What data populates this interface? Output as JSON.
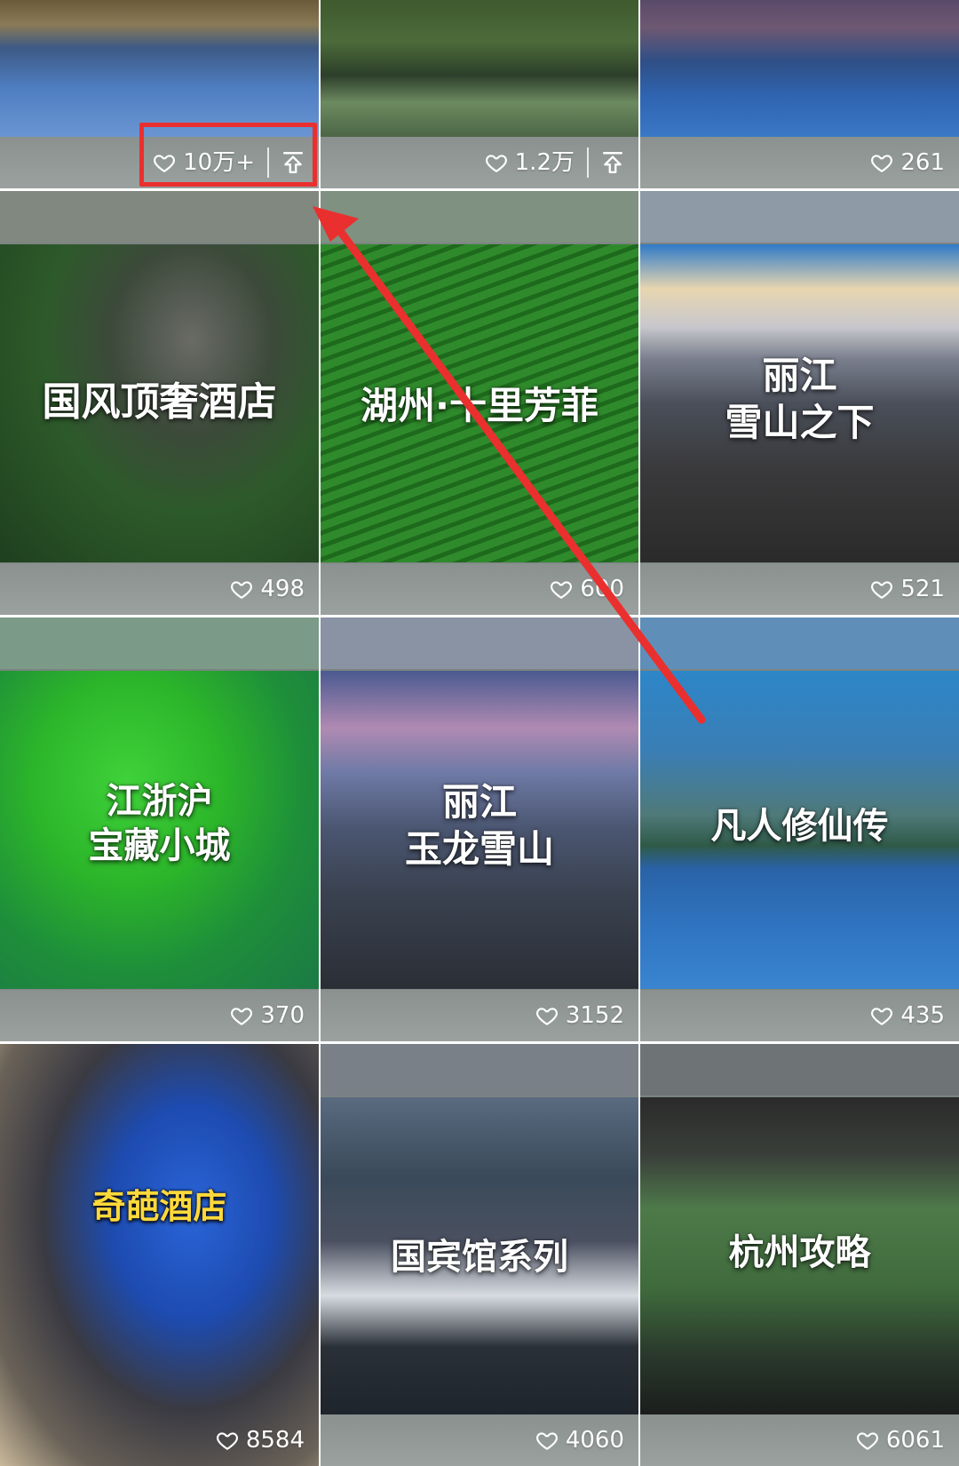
{
  "tiles": [
    {
      "likes": "10万+",
      "caption": "",
      "pinned": true
    },
    {
      "likes": "1.2万",
      "caption": "",
      "pinned": true
    },
    {
      "likes": "261",
      "caption": "",
      "pinned": false
    },
    {
      "likes": "498",
      "caption": "国风顶奢酒店",
      "pinned": false
    },
    {
      "likes": "600",
      "caption": "湖州·十里芳菲",
      "pinned": false
    },
    {
      "likes": "521",
      "caption": "丽江\n雪山之下",
      "pinned": false
    },
    {
      "likes": "370",
      "caption": "江浙沪\n宝藏小城",
      "pinned": false
    },
    {
      "likes": "3152",
      "caption": "丽江\n玉龙雪山",
      "pinned": false
    },
    {
      "likes": "435",
      "caption": "凡人修仙传",
      "pinned": false
    },
    {
      "likes": "8584",
      "caption": "奇葩酒店",
      "pinned": false
    },
    {
      "likes": "4060",
      "caption": "国宾馆系列",
      "pinned": false
    },
    {
      "likes": "6061",
      "caption": "杭州攻略",
      "pinned": false
    }
  ],
  "icons": {
    "like": "heart-outline-icon",
    "pin": "pin-to-top-icon"
  },
  "annotation_color": "#ea2f2f"
}
